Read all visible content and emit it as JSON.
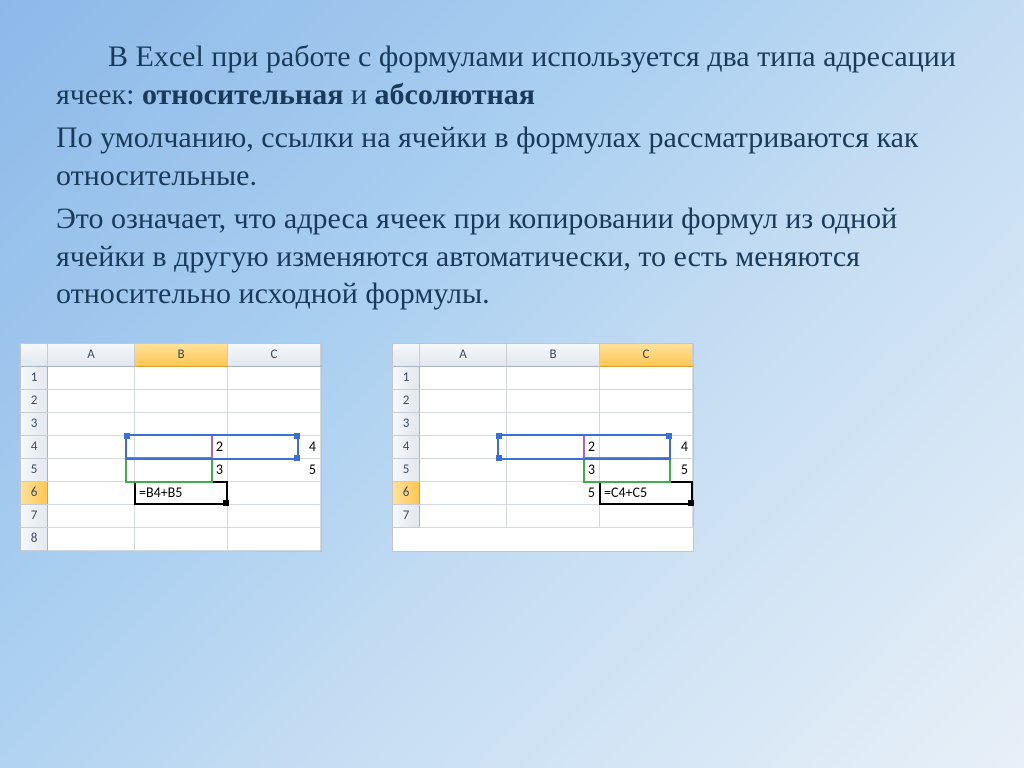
{
  "text": {
    "p1a": "В Excel при работе с формулами используется два типа адресации ячеек: ",
    "p1b_bold": "относительная",
    "p1c": " и ",
    "p1d_bold": "абсолютная",
    "p2": "По умолчанию, ссылки на ячейки в формулах рассматриваются как относительные.",
    "p3": "Это означает, что адреса ячеек при копировании формул из одной ячейки в другую изменяются автоматически, то есть меняются относительно исходной формулы."
  },
  "excel1": {
    "columns": [
      "",
      "A",
      "B",
      "C"
    ],
    "highlight_col": "B",
    "rows": [
      "1",
      "2",
      "3",
      "4",
      "5",
      "6",
      "7",
      "8"
    ],
    "highlight_row": "6",
    "data": {
      "B4": "2",
      "C4": "4",
      "B5": "3",
      "C5": "5",
      "B6": "=B4+B5"
    },
    "formula_cell": "B6",
    "range_blue": "B4:C4",
    "range_green": "B5",
    "range_purple": "B4"
  },
  "excel2": {
    "columns": [
      "",
      "A",
      "B",
      "C"
    ],
    "highlight_col": "C",
    "rows": [
      "1",
      "2",
      "3",
      "4",
      "5",
      "6",
      "7"
    ],
    "highlight_row": "6",
    "data": {
      "B4": "2",
      "C4": "4",
      "B5": "3",
      "C5": "5",
      "B6": "5",
      "C6": "=C4+C5"
    },
    "formula_cell": "C6",
    "range_blue": "B4:C4",
    "range_green": "C5",
    "range_purple": "C4"
  }
}
